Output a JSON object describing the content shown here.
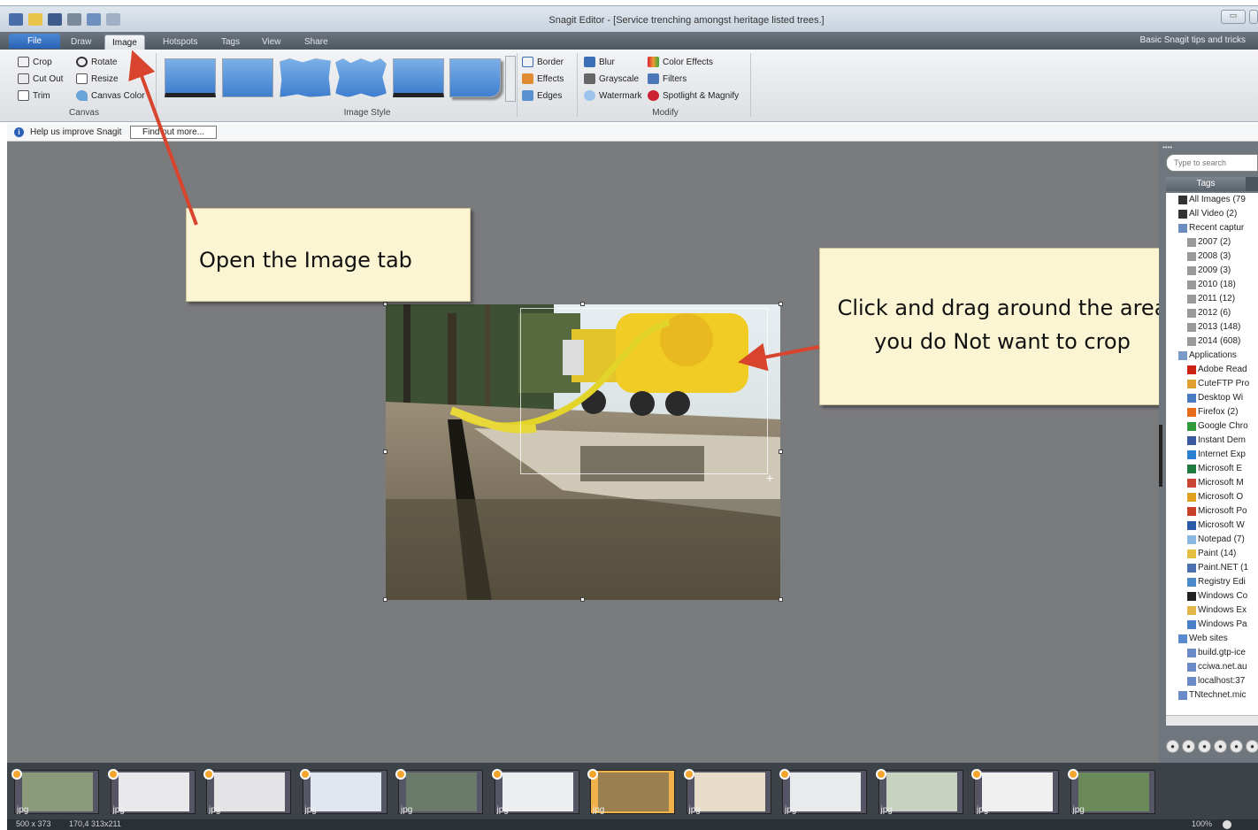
{
  "window": {
    "title": "Snagit Editor - [Service trenching amongst heritage listed trees.]"
  },
  "tabs": [
    {
      "label": "File"
    },
    {
      "label": "Draw"
    },
    {
      "label": "Image"
    },
    {
      "label": "Hotspots"
    },
    {
      "label": "Tags"
    },
    {
      "label": "View"
    },
    {
      "label": "Share"
    }
  ],
  "help_link": "Basic Snagit tips and tricks",
  "ribbon": {
    "canvas_group": {
      "label": "Canvas",
      "crop": "Crop",
      "rotate": "Rotate",
      "cut_out": "Cut Out",
      "resize": "Resize",
      "trim": "Trim",
      "canvas_color": "Canvas Color"
    },
    "image_style_group": {
      "label": "Image Style"
    },
    "border_group": {
      "border": "Border",
      "effects": "Effects",
      "edges": "Edges"
    },
    "modify_group": {
      "label": "Modify",
      "blur": "Blur",
      "grayscale": "Grayscale",
      "watermark": "Watermark",
      "color_effects": "Color Effects",
      "filters": "Filters",
      "spotlight": "Spotlight & Magnify"
    }
  },
  "infobar": {
    "text": "Help us improve Snagit",
    "button": "Find out more..."
  },
  "callouts": {
    "first": "Open the Image tab",
    "second": "Click and drag around the area you do Not want to crop"
  },
  "panel": {
    "search_placeholder": "Type to search",
    "tags_header": "Tags",
    "tags": [
      {
        "label": "All Images (79",
        "icon": "images-icon",
        "indent": 1
      },
      {
        "label": "All Video (2)",
        "icon": "video-icon",
        "indent": 1
      },
      {
        "label": "Recent captur",
        "icon": "recent-icon",
        "indent": 1
      },
      {
        "label": "2007 (2)",
        "icon": "date-icon",
        "indent": 2
      },
      {
        "label": "2008 (3)",
        "icon": "date-icon",
        "indent": 2
      },
      {
        "label": "2009 (3)",
        "icon": "date-icon",
        "indent": 2
      },
      {
        "label": "2010 (18)",
        "icon": "date-icon",
        "indent": 2
      },
      {
        "label": "2011 (12)",
        "icon": "date-icon",
        "indent": 2
      },
      {
        "label": "2012 (6)",
        "icon": "date-icon",
        "indent": 2
      },
      {
        "label": "2013 (148)",
        "icon": "date-icon",
        "indent": 2
      },
      {
        "label": "2014 (608)",
        "icon": "date-icon",
        "indent": 2
      },
      {
        "label": "Applications",
        "icon": "apps-icon",
        "indent": 1
      },
      {
        "label": "Adobe Read",
        "icon": "adobe-icon",
        "indent": 2
      },
      {
        "label": "CuteFTP Pro",
        "icon": "ftp-icon",
        "indent": 2
      },
      {
        "label": "Desktop Wi",
        "icon": "desktop-icon",
        "indent": 2
      },
      {
        "label": "Firefox (2)",
        "icon": "firefox-icon",
        "indent": 2
      },
      {
        "label": "Google Chro",
        "icon": "chrome-icon",
        "indent": 2
      },
      {
        "label": "Instant Dem",
        "icon": "demo-icon",
        "indent": 2
      },
      {
        "label": "Internet Exp",
        "icon": "ie-icon",
        "indent": 2
      },
      {
        "label": "Microsoft E",
        "icon": "excel-icon",
        "indent": 2
      },
      {
        "label": "Microsoft M",
        "icon": "msm-icon",
        "indent": 2
      },
      {
        "label": "Microsoft O",
        "icon": "outlook-icon",
        "indent": 2
      },
      {
        "label": "Microsoft Po",
        "icon": "powerpoint-icon",
        "indent": 2
      },
      {
        "label": "Microsoft W",
        "icon": "word-icon",
        "indent": 2
      },
      {
        "label": "Notepad (7)",
        "icon": "notepad-icon",
        "indent": 2
      },
      {
        "label": "Paint (14)",
        "icon": "paint-icon",
        "indent": 2
      },
      {
        "label": "Paint.NET (1",
        "icon": "paintnet-icon",
        "indent": 2
      },
      {
        "label": "Registry Edi",
        "icon": "registry-icon",
        "indent": 2
      },
      {
        "label": "Windows Co",
        "icon": "console-icon",
        "indent": 2
      },
      {
        "label": "Windows Ex",
        "icon": "explorer-icon",
        "indent": 2
      },
      {
        "label": "Windows Pa",
        "icon": "winpaint-icon",
        "indent": 2
      },
      {
        "label": "Web sites",
        "icon": "web-icon",
        "indent": 1
      },
      {
        "label": "build.gtp-ice",
        "icon": "link-icon",
        "indent": 2
      },
      {
        "label": "cciwa.net.au",
        "icon": "link-icon",
        "indent": 2
      },
      {
        "label": "localhost:37",
        "icon": "link-icon",
        "indent": 2
      },
      {
        "label": "TNtechnet.mic",
        "icon": "link-icon",
        "indent": 1
      }
    ]
  },
  "tray": {
    "items": [
      {
        "label": "jpg",
        "selected": false
      },
      {
        "label": "jpg",
        "selected": false
      },
      {
        "label": "jpg",
        "selected": false
      },
      {
        "label": "jpg",
        "selected": false
      },
      {
        "label": "jpg",
        "selected": false
      },
      {
        "label": "jpg",
        "selected": false
      },
      {
        "label": "jpg",
        "selected": true
      },
      {
        "label": "jpg",
        "selected": false
      },
      {
        "label": "jpg",
        "selected": false
      },
      {
        "label": "jpg",
        "selected": false
      },
      {
        "label": "jpg",
        "selected": false
      },
      {
        "label": "jpg",
        "selected": false
      }
    ]
  },
  "status": {
    "size": "500 x 373",
    "position": "170,4  313x211",
    "zoom": "100%"
  },
  "colors": {
    "callout_bg": "#fbf5d3",
    "arrow": "#d8442e",
    "canvas_bg": "#7a7b7c"
  }
}
